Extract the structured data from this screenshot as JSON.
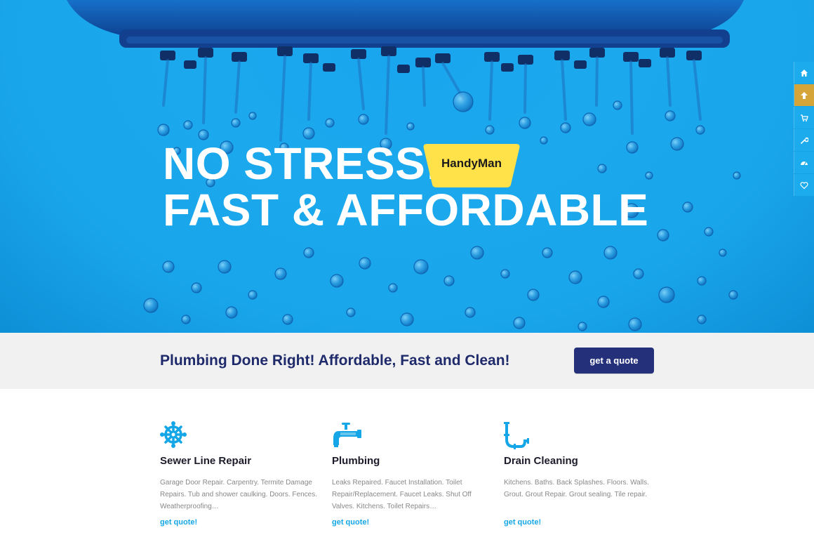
{
  "hero": {
    "line1": "NO STRESS!",
    "line2": "FAST & AFFORDABLE",
    "logo_text": "HandyMan"
  },
  "side_nav": [
    {
      "icon": "home-icon"
    },
    {
      "icon": "arrow-up-icon",
      "active": true
    },
    {
      "icon": "cart-icon"
    },
    {
      "icon": "wrench-icon"
    },
    {
      "icon": "gauge-icon"
    },
    {
      "icon": "heart-icon"
    }
  ],
  "cta": {
    "text": "Plumbing Done Right! Affordable, Fast and Clean!",
    "button_label": "get a quote"
  },
  "services": [
    {
      "icon": "valve-icon",
      "title": "Sewer Line Repair",
      "description": "Garage Door Repair. Carpentry. Termite Damage Repairs. Tub and shower caulking. Doors. Fences. Weatherproofing…",
      "link": "get quote!"
    },
    {
      "icon": "faucet-icon",
      "title": "Plumbing",
      "description": "Leaks Repaired. Faucet Installation. Toilet Repair/Replacement. Faucet Leaks. Shut Off Valves. Kitchens. Toilet Repairs…",
      "link": "get quote!"
    },
    {
      "icon": "drain-pipe-icon",
      "title": "Drain Cleaning",
      "description": "Kitchens. Baths. Back Splashes. Floors. Walls. Grout. Grout Repair. Grout sealing. Tile repair.",
      "link": "get quote!"
    }
  ],
  "colors": {
    "hero_blue": "#1aa6ee",
    "side_active": "#d5a53a",
    "navy": "#24307a",
    "link_blue": "#14a6e6",
    "badge_yellow": "#ffe24a"
  }
}
